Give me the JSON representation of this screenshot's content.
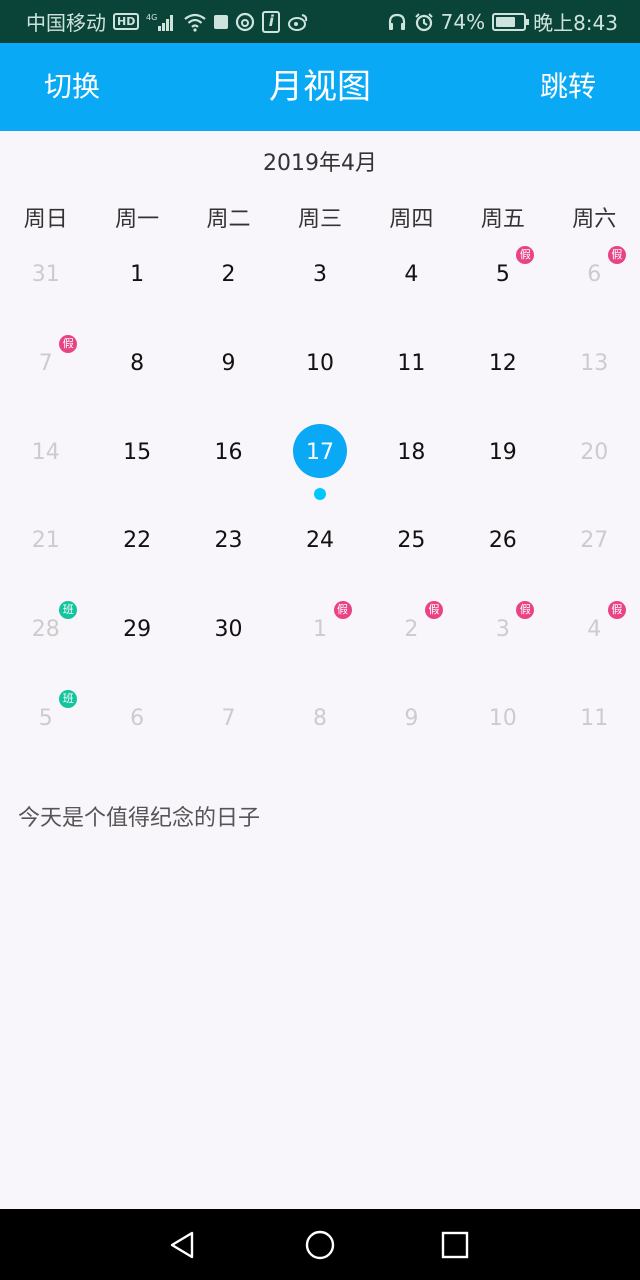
{
  "statusbar": {
    "carrier": "中国移动",
    "hd": "HD",
    "battery_percent": "74%",
    "battery_level": 0.74,
    "time": "晚上8:43"
  },
  "appbar": {
    "left_button": "切换",
    "title": "月视图",
    "right_button": "跳转"
  },
  "calendar": {
    "month_label": "2019年4月",
    "weekdays": [
      "周日",
      "周一",
      "周二",
      "周三",
      "周四",
      "周五",
      "周六"
    ],
    "weeks": [
      [
        {
          "day": "31",
          "current": false,
          "badge": null,
          "selected": false
        },
        {
          "day": "1",
          "current": true,
          "badge": null,
          "selected": false
        },
        {
          "day": "2",
          "current": true,
          "badge": null,
          "selected": false
        },
        {
          "day": "3",
          "current": true,
          "badge": null,
          "selected": false
        },
        {
          "day": "4",
          "current": true,
          "badge": null,
          "selected": false
        },
        {
          "day": "5",
          "current": true,
          "badge": "假",
          "selected": false
        },
        {
          "day": "6",
          "current": false,
          "badge": "假",
          "selected": false
        }
      ],
      [
        {
          "day": "7",
          "current": false,
          "badge": "假",
          "selected": false
        },
        {
          "day": "8",
          "current": true,
          "badge": null,
          "selected": false
        },
        {
          "day": "9",
          "current": true,
          "badge": null,
          "selected": false
        },
        {
          "day": "10",
          "current": true,
          "badge": null,
          "selected": false
        },
        {
          "day": "11",
          "current": true,
          "badge": null,
          "selected": false
        },
        {
          "day": "12",
          "current": true,
          "badge": null,
          "selected": false
        },
        {
          "day": "13",
          "current": false,
          "badge": null,
          "selected": false
        }
      ],
      [
        {
          "day": "14",
          "current": false,
          "badge": null,
          "selected": false
        },
        {
          "day": "15",
          "current": true,
          "badge": null,
          "selected": false
        },
        {
          "day": "16",
          "current": true,
          "badge": null,
          "selected": false
        },
        {
          "day": "17",
          "current": true,
          "badge": null,
          "selected": true
        },
        {
          "day": "18",
          "current": true,
          "badge": null,
          "selected": false
        },
        {
          "day": "19",
          "current": true,
          "badge": null,
          "selected": false
        },
        {
          "day": "20",
          "current": false,
          "badge": null,
          "selected": false
        }
      ],
      [
        {
          "day": "21",
          "current": false,
          "badge": null,
          "selected": false
        },
        {
          "day": "22",
          "current": true,
          "badge": null,
          "selected": false
        },
        {
          "day": "23",
          "current": true,
          "badge": null,
          "selected": false
        },
        {
          "day": "24",
          "current": true,
          "badge": null,
          "selected": false
        },
        {
          "day": "25",
          "current": true,
          "badge": null,
          "selected": false
        },
        {
          "day": "26",
          "current": true,
          "badge": null,
          "selected": false
        },
        {
          "day": "27",
          "current": false,
          "badge": null,
          "selected": false
        }
      ],
      [
        {
          "day": "28",
          "current": false,
          "badge": "班",
          "selected": false
        },
        {
          "day": "29",
          "current": true,
          "badge": null,
          "selected": false
        },
        {
          "day": "30",
          "current": true,
          "badge": null,
          "selected": false
        },
        {
          "day": "1",
          "current": false,
          "badge": "假",
          "selected": false
        },
        {
          "day": "2",
          "current": false,
          "badge": "假",
          "selected": false
        },
        {
          "day": "3",
          "current": false,
          "badge": "假",
          "selected": false
        },
        {
          "day": "4",
          "current": false,
          "badge": "假",
          "selected": false
        }
      ],
      [
        {
          "day": "5",
          "current": false,
          "badge": "班",
          "selected": false
        },
        {
          "day": "6",
          "current": false,
          "badge": null,
          "selected": false
        },
        {
          "day": "7",
          "current": false,
          "badge": null,
          "selected": false
        },
        {
          "day": "8",
          "current": false,
          "badge": null,
          "selected": false
        },
        {
          "day": "9",
          "current": false,
          "badge": null,
          "selected": false
        },
        {
          "day": "10",
          "current": false,
          "badge": null,
          "selected": false
        },
        {
          "day": "11",
          "current": false,
          "badge": null,
          "selected": false
        }
      ]
    ]
  },
  "note": "今天是个值得纪念的日子",
  "colors": {
    "primary": "#0aa9f5",
    "holiday_badge": "#e94386",
    "workday_badge": "#14c49d",
    "status_bar": "#0a4438"
  },
  "icons": {
    "status": [
      "hd-icon",
      "4g-signal-icon",
      "wifi-icon",
      "notification-square-icon",
      "netease-icon",
      "info-icon",
      "weibo-icon",
      "headphones-icon",
      "alarm-icon",
      "battery-icon"
    ],
    "nav": [
      "back-icon",
      "home-icon",
      "recents-icon"
    ]
  }
}
